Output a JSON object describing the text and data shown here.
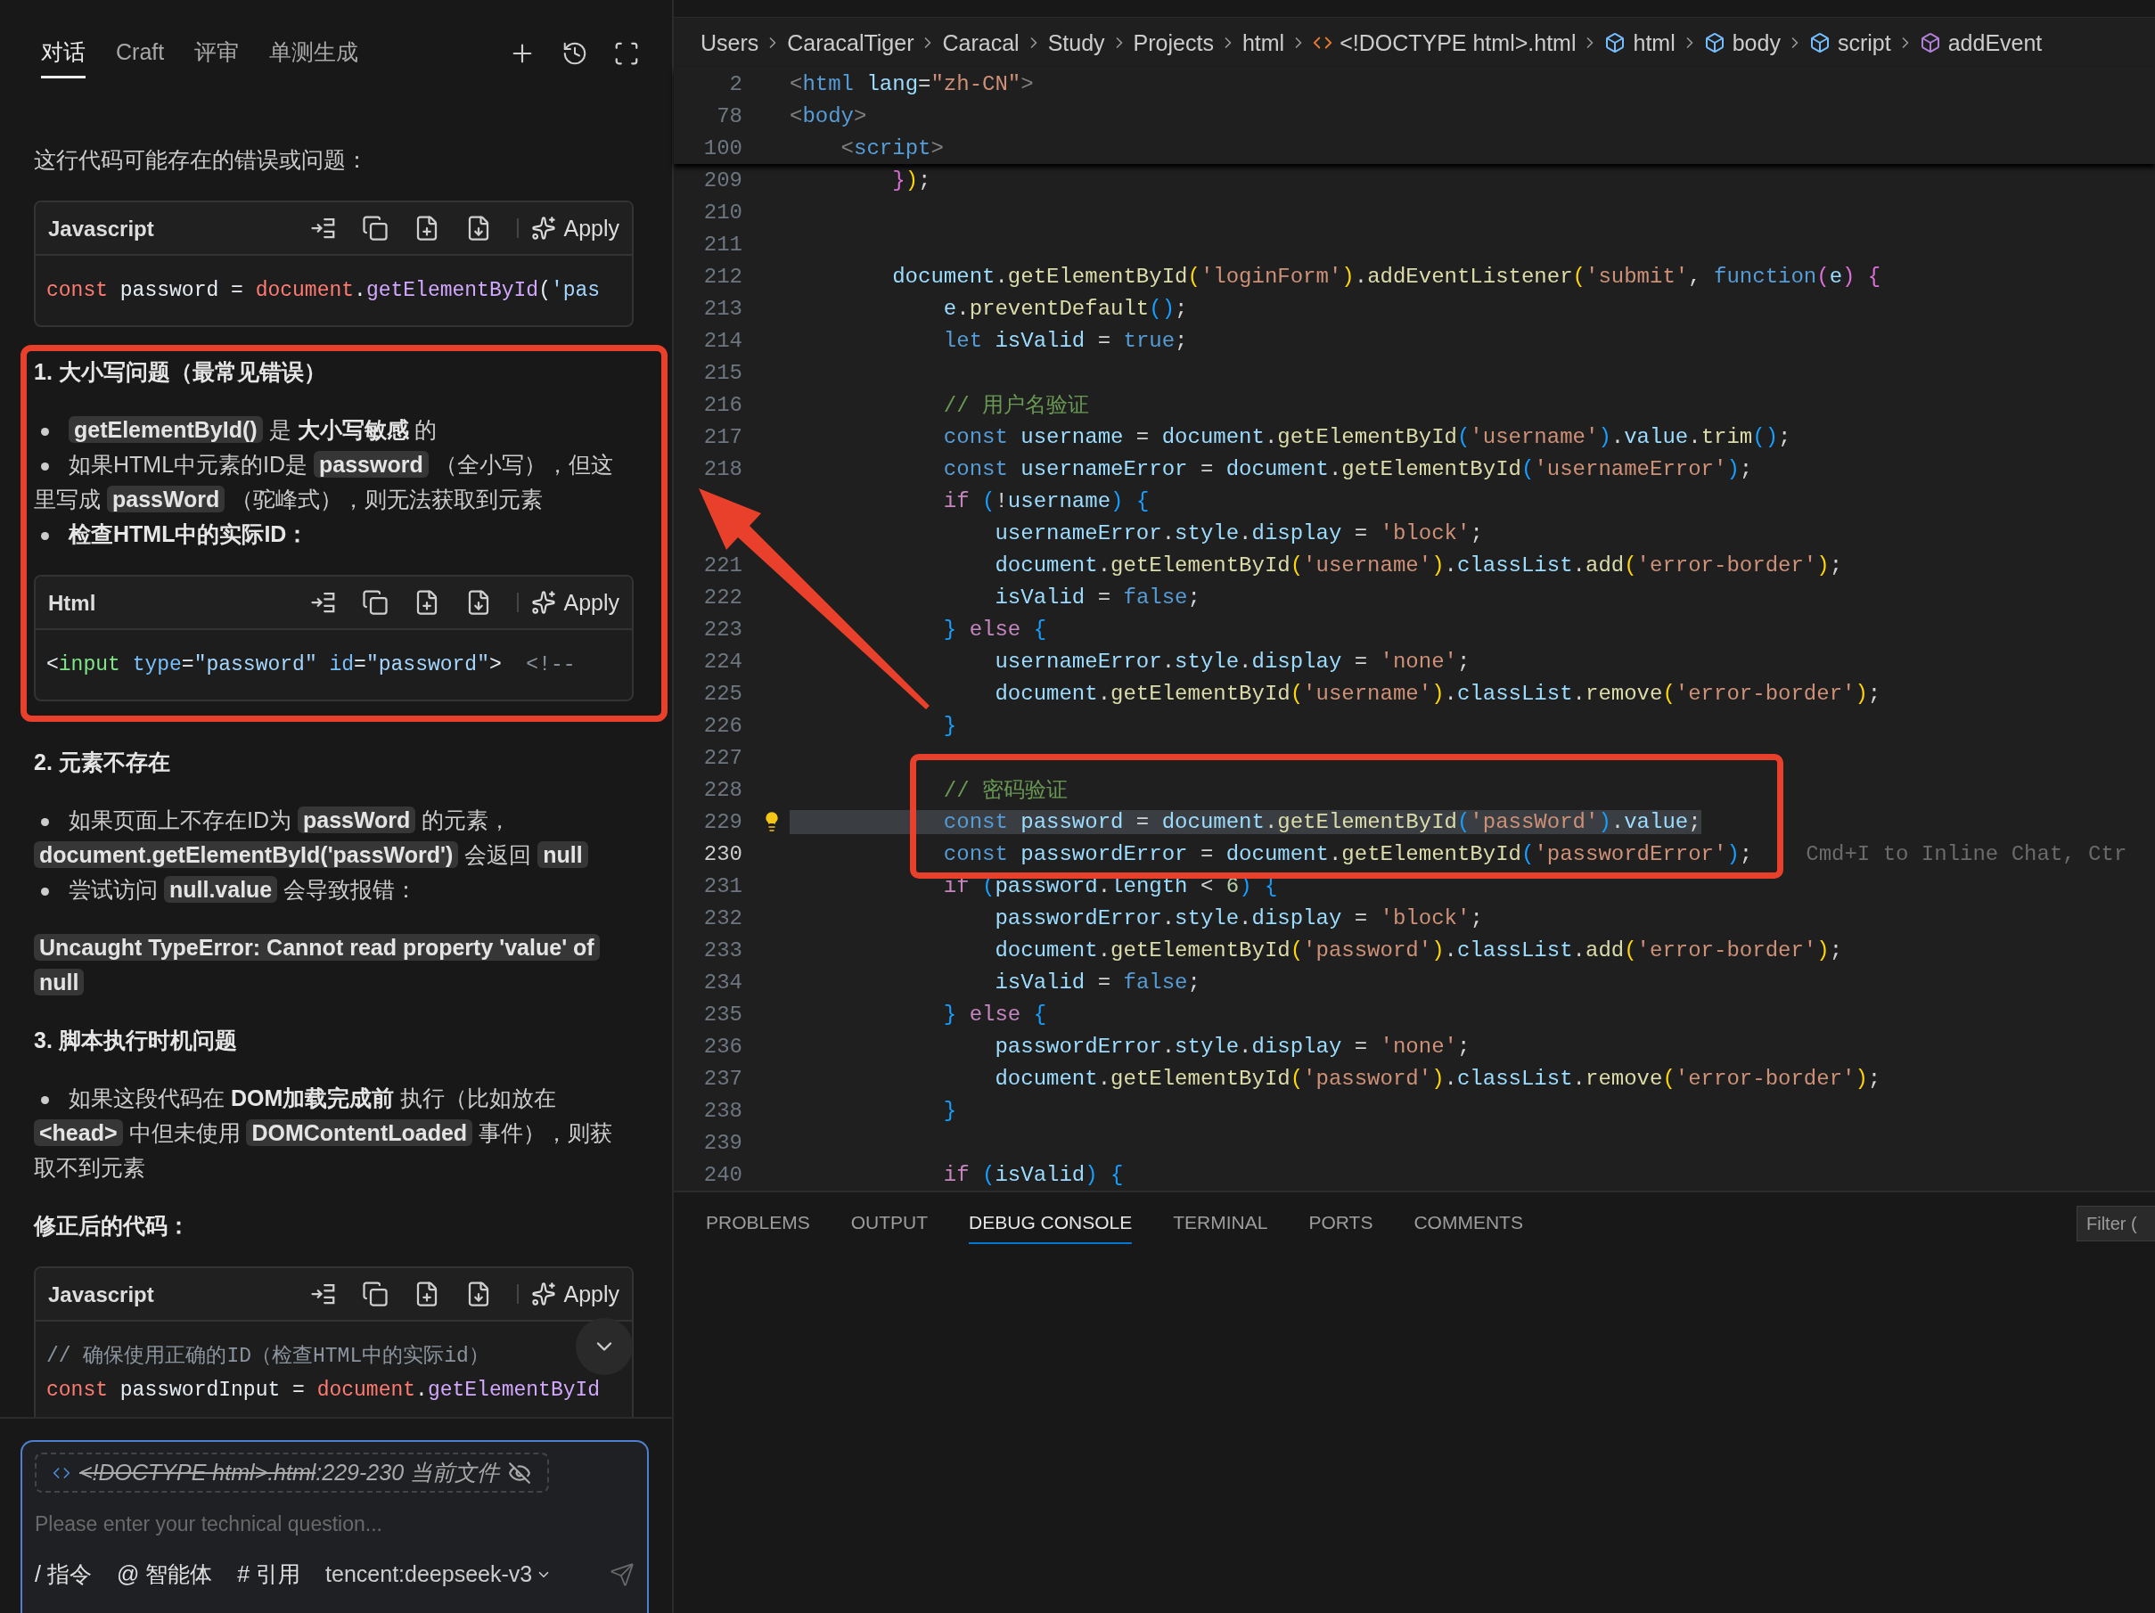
{
  "chat": {
    "tabs": [
      {
        "label": "对话",
        "selected": true
      },
      {
        "label": "Craft",
        "selected": false
      },
      {
        "label": "评审",
        "selected": false
      },
      {
        "label": "单测生成",
        "selected": false
      }
    ],
    "blocks": [
      {
        "kind": "paragraph",
        "highlighted": false,
        "segments": [
          {
            "kind": "text",
            "text": "这行代码可能存在的错误或问题："
          }
        ]
      },
      {
        "kind": "code",
        "highlighted": false,
        "language": "Javascript",
        "action": "Apply",
        "lines": [
          [
            {
              "kind": "keyword",
              "text": "const"
            },
            {
              "kind": "plain",
              "text": " password = "
            },
            {
              "kind": "keyword",
              "text": "document"
            },
            {
              "kind": "plain",
              "text": "."
            },
            {
              "kind": "function",
              "text": "getElementById"
            },
            {
              "kind": "plain",
              "text": "("
            },
            {
              "kind": "string",
              "text": "'pas"
            }
          ]
        ]
      },
      {
        "kind": "heading",
        "highlighted": true,
        "text": "1. 大小写问题（最常见错误）"
      },
      {
        "kind": "bullets",
        "highlighted": true,
        "items": [
          [
            {
              "kind": "code",
              "text": "getElementById()"
            },
            {
              "kind": "text",
              "text": " 是 "
            },
            {
              "kind": "bold",
              "text": "大小写敏感"
            },
            {
              "kind": "text",
              "text": " 的"
            }
          ],
          [
            {
              "kind": "text",
              "text": "如果HTML中元素的ID是 "
            },
            {
              "kind": "code",
              "text": "password"
            },
            {
              "kind": "text",
              "text": " （全小写），但这里写成 "
            },
            {
              "kind": "code",
              "text": "passWord"
            },
            {
              "kind": "text",
              "text": " （驼峰式），则无法获取到元素"
            }
          ],
          [
            {
              "kind": "bold",
              "text": "检查HTML中的实际ID："
            }
          ]
        ]
      },
      {
        "kind": "code",
        "highlighted": true,
        "language": "Html",
        "action": "Apply",
        "lines": [
          [
            {
              "kind": "plain",
              "text": "<"
            },
            {
              "kind": "tag",
              "text": "input"
            },
            {
              "kind": "attribute",
              "text": " type"
            },
            {
              "kind": "plain",
              "text": "="
            },
            {
              "kind": "string",
              "text": "\"password\""
            },
            {
              "kind": "attribute",
              "text": " id"
            },
            {
              "kind": "plain",
              "text": "="
            },
            {
              "kind": "string",
              "text": "\"password\""
            },
            {
              "kind": "plain",
              "text": ">"
            },
            {
              "kind": "comment",
              "text": "  <!--"
            }
          ]
        ]
      },
      {
        "kind": "heading",
        "highlighted": false,
        "text": "2. 元素不存在"
      },
      {
        "kind": "bullets",
        "highlighted": false,
        "items": [
          [
            {
              "kind": "text",
              "text": "如果页面上不存在ID为 "
            },
            {
              "kind": "code",
              "text": "passWord"
            },
            {
              "kind": "text",
              "text": " 的元素，"
            },
            {
              "kind": "code",
              "text": "document.getElementById('passWord')"
            },
            {
              "kind": "text",
              "text": " 会返回 "
            },
            {
              "kind": "code",
              "text": "null"
            }
          ],
          [
            {
              "kind": "text",
              "text": "尝试访问 "
            },
            {
              "kind": "code",
              "text": "null.value"
            },
            {
              "kind": "text",
              "text": " 会导致报错："
            }
          ]
        ]
      },
      {
        "kind": "paragraph",
        "highlighted": false,
        "segments": [
          {
            "kind": "code",
            "text": "Uncaught TypeError: Cannot read property 'value' of null"
          }
        ]
      },
      {
        "kind": "heading",
        "highlighted": false,
        "text": "3. 脚本执行时机问题"
      },
      {
        "kind": "bullets",
        "highlighted": false,
        "items": [
          [
            {
              "kind": "text",
              "text": "如果这段代码在 "
            },
            {
              "kind": "bold",
              "text": "DOM加载完成前"
            },
            {
              "kind": "text",
              "text": " 执行（比如放在 "
            },
            {
              "kind": "code",
              "text": "<head>"
            },
            {
              "kind": "text",
              "text": " 中但未使用 "
            },
            {
              "kind": "code",
              "text": "DOMContentLoaded"
            },
            {
              "kind": "text",
              "text": " 事件），则获取不到元素"
            }
          ]
        ]
      },
      {
        "kind": "heading",
        "highlighted": false,
        "text": "修正后的代码："
      },
      {
        "kind": "code",
        "highlighted": false,
        "language": "Javascript",
        "action": "Apply",
        "lines": [
          [
            {
              "kind": "comment",
              "text": "// 确保使用正确的ID（检查HTML中的实际id）"
            }
          ],
          [
            {
              "kind": "keyword",
              "text": "const"
            },
            {
              "kind": "plain",
              "text": " passwordInput = "
            },
            {
              "kind": "keyword",
              "text": "document"
            },
            {
              "kind": "plain",
              "text": "."
            },
            {
              "kind": "function",
              "text": "getElementById"
            }
          ]
        ]
      }
    ],
    "input": {
      "context": {
        "file": "<!DOCTYPE html>.html",
        "range": ":229-230",
        "label": "当前文件",
        "enabled": false
      },
      "placeholder": "Please enter your technical question...",
      "commands": [
        "/ 指令",
        "@ 智能体",
        "# 引用"
      ],
      "model": "tencent:deepseek-v3"
    }
  },
  "editor": {
    "breadcrumb": [
      {
        "label": "Users",
        "kind": "folder"
      },
      {
        "label": "CaracalTiger",
        "kind": "folder"
      },
      {
        "label": "Caracal",
        "kind": "folder"
      },
      {
        "label": "Study",
        "kind": "folder"
      },
      {
        "label": "Projects",
        "kind": "folder"
      },
      {
        "label": "html",
        "kind": "folder"
      },
      {
        "label": "<!DOCTYPE html>.html",
        "kind": "file"
      },
      {
        "label": "html",
        "kind": "element"
      },
      {
        "label": "body",
        "kind": "element"
      },
      {
        "label": "script",
        "kind": "element"
      },
      {
        "label": "addEvent",
        "kind": "function"
      }
    ],
    "sticky_lines": [
      {
        "number": "2",
        "tokens": [
          {
            "kind": "punct",
            "text": "<"
          },
          {
            "kind": "tag",
            "text": "html"
          },
          {
            "kind": "variable",
            "text": " lang"
          },
          {
            "kind": "plain",
            "text": "="
          },
          {
            "kind": "string",
            "text": "\"zh-CN\""
          },
          {
            "kind": "punct",
            "text": ">"
          }
        ]
      },
      {
        "number": "78",
        "tokens": [
          {
            "kind": "punct",
            "text": "<"
          },
          {
            "kind": "tag",
            "text": "body"
          },
          {
            "kind": "punct",
            "text": ">"
          }
        ]
      },
      {
        "number": "100",
        "tokens": [
          {
            "kind": "punct",
            "text": "    <"
          },
          {
            "kind": "tag",
            "text": "script"
          },
          {
            "kind": "punct",
            "text": ">"
          }
        ]
      }
    ],
    "lines": [
      {
        "number": "209",
        "tokens": [
          {
            "kind": "bracket_b",
            "text": "        }"
          },
          {
            "kind": "bracket_a",
            "text": ")"
          },
          {
            "kind": "plain",
            "text": ";"
          }
        ]
      },
      {
        "number": "210"
      },
      {
        "number": "211"
      },
      {
        "number": "212",
        "tokens": [
          {
            "kind": "variable",
            "text": "        document"
          },
          {
            "kind": "plain",
            "text": "."
          },
          {
            "kind": "function",
            "text": "getElementById"
          },
          {
            "kind": "bracket_a",
            "text": "("
          },
          {
            "kind": "string",
            "text": "'loginForm'"
          },
          {
            "kind": "bracket_a",
            "text": ")"
          },
          {
            "kind": "plain",
            "text": "."
          },
          {
            "kind": "function",
            "text": "addEventListener"
          },
          {
            "kind": "bracket_a",
            "text": "("
          },
          {
            "kind": "string",
            "text": "'submit'"
          },
          {
            "kind": "plain",
            "text": ", "
          },
          {
            "kind": "keyword",
            "text": "function"
          },
          {
            "kind": "bracket_b",
            "text": "("
          },
          {
            "kind": "variable",
            "text": "e"
          },
          {
            "kind": "bracket_b",
            "text": ") {"
          }
        ]
      },
      {
        "number": "213",
        "tokens": [
          {
            "kind": "variable",
            "text": "            e"
          },
          {
            "kind": "plain",
            "text": "."
          },
          {
            "kind": "function",
            "text": "preventDefault"
          },
          {
            "kind": "bracket_c",
            "text": "()"
          },
          {
            "kind": "plain",
            "text": ";"
          }
        ]
      },
      {
        "number": "214",
        "tokens": [
          {
            "kind": "keyword",
            "text": "            let"
          },
          {
            "kind": "variable",
            "text": " isValid"
          },
          {
            "kind": "plain",
            "text": " = "
          },
          {
            "kind": "keyword",
            "text": "true"
          },
          {
            "kind": "plain",
            "text": ";"
          }
        ]
      },
      {
        "number": "215"
      },
      {
        "number": "216",
        "tokens": [
          {
            "kind": "comment",
            "text": "            // 用户名验证"
          }
        ]
      },
      {
        "number": "217",
        "tokens": [
          {
            "kind": "keyword",
            "text": "            const"
          },
          {
            "kind": "variable",
            "text": " username"
          },
          {
            "kind": "plain",
            "text": " = "
          },
          {
            "kind": "variable",
            "text": "document"
          },
          {
            "kind": "plain",
            "text": "."
          },
          {
            "kind": "function",
            "text": "getElementById"
          },
          {
            "kind": "bracket_c",
            "text": "("
          },
          {
            "kind": "string",
            "text": "'username'"
          },
          {
            "kind": "bracket_c",
            "text": ")"
          },
          {
            "kind": "plain",
            "text": "."
          },
          {
            "kind": "variable",
            "text": "value"
          },
          {
            "kind": "plain",
            "text": "."
          },
          {
            "kind": "function",
            "text": "trim"
          },
          {
            "kind": "bracket_c",
            "text": "()"
          },
          {
            "kind": "plain",
            "text": ";"
          }
        ]
      },
      {
        "number": "218",
        "tokens": [
          {
            "kind": "keyword",
            "text": "            const"
          },
          {
            "kind": "variable",
            "text": " usernameError"
          },
          {
            "kind": "plain",
            "text": " = "
          },
          {
            "kind": "variable",
            "text": "document"
          },
          {
            "kind": "plain",
            "text": "."
          },
          {
            "kind": "function",
            "text": "getElementById"
          },
          {
            "kind": "bracket_c",
            "text": "("
          },
          {
            "kind": "string",
            "text": "'usernameError'"
          },
          {
            "kind": "bracket_c",
            "text": ")"
          },
          {
            "kind": "plain",
            "text": ";"
          }
        ]
      },
      {
        "tokens": [
          {
            "kind": "control",
            "text": "            if"
          },
          {
            "kind": "bracket_c",
            "text": " ("
          },
          {
            "kind": "plain",
            "text": "!"
          },
          {
            "kind": "variable",
            "text": "username"
          },
          {
            "kind": "bracket_c",
            "text": ") {"
          }
        ]
      },
      {
        "tokens": [
          {
            "kind": "variable",
            "text": "                usernameError"
          },
          {
            "kind": "plain",
            "text": "."
          },
          {
            "kind": "variable",
            "text": "style"
          },
          {
            "kind": "plain",
            "text": "."
          },
          {
            "kind": "variable",
            "text": "display"
          },
          {
            "kind": "plain",
            "text": " = "
          },
          {
            "kind": "string",
            "text": "'block'"
          },
          {
            "kind": "plain",
            "text": ";"
          }
        ]
      },
      {
        "number": "221",
        "tokens": [
          {
            "kind": "variable",
            "text": "                document"
          },
          {
            "kind": "plain",
            "text": "."
          },
          {
            "kind": "function",
            "text": "getElementById"
          },
          {
            "kind": "bracket_a",
            "text": "("
          },
          {
            "kind": "string",
            "text": "'username'"
          },
          {
            "kind": "bracket_a",
            "text": ")"
          },
          {
            "kind": "plain",
            "text": "."
          },
          {
            "kind": "variable",
            "text": "classList"
          },
          {
            "kind": "plain",
            "text": "."
          },
          {
            "kind": "function",
            "text": "add"
          },
          {
            "kind": "bracket_a",
            "text": "("
          },
          {
            "kind": "string",
            "text": "'error-border'"
          },
          {
            "kind": "bracket_a",
            "text": ")"
          },
          {
            "kind": "plain",
            "text": ";"
          }
        ]
      },
      {
        "number": "222",
        "tokens": [
          {
            "kind": "variable",
            "text": "                isValid"
          },
          {
            "kind": "plain",
            "text": " = "
          },
          {
            "kind": "keyword",
            "text": "false"
          },
          {
            "kind": "plain",
            "text": ";"
          }
        ]
      },
      {
        "number": "223",
        "tokens": [
          {
            "kind": "bracket_c",
            "text": "            }"
          },
          {
            "kind": "control",
            "text": " else"
          },
          {
            "kind": "bracket_c",
            "text": " {"
          }
        ]
      },
      {
        "number": "224",
        "tokens": [
          {
            "kind": "variable",
            "text": "                usernameError"
          },
          {
            "kind": "plain",
            "text": "."
          },
          {
            "kind": "variable",
            "text": "style"
          },
          {
            "kind": "plain",
            "text": "."
          },
          {
            "kind": "variable",
            "text": "display"
          },
          {
            "kind": "plain",
            "text": " = "
          },
          {
            "kind": "string",
            "text": "'none'"
          },
          {
            "kind": "plain",
            "text": ";"
          }
        ]
      },
      {
        "number": "225",
        "tokens": [
          {
            "kind": "variable",
            "text": "                document"
          },
          {
            "kind": "plain",
            "text": "."
          },
          {
            "kind": "function",
            "text": "getElementById"
          },
          {
            "kind": "bracket_a",
            "text": "("
          },
          {
            "kind": "string",
            "text": "'username'"
          },
          {
            "kind": "bracket_a",
            "text": ")"
          },
          {
            "kind": "plain",
            "text": "."
          },
          {
            "kind": "variable",
            "text": "classList"
          },
          {
            "kind": "plain",
            "text": "."
          },
          {
            "kind": "function",
            "text": "remove"
          },
          {
            "kind": "bracket_a",
            "text": "("
          },
          {
            "kind": "string",
            "text": "'error-border'"
          },
          {
            "kind": "bracket_a",
            "text": ")"
          },
          {
            "kind": "plain",
            "text": ";"
          }
        ]
      },
      {
        "number": "226",
        "tokens": [
          {
            "kind": "bracket_c",
            "text": "            }"
          }
        ]
      },
      {
        "number": "227"
      },
      {
        "number": "228",
        "boxed": true,
        "tokens": [
          {
            "kind": "comment",
            "text": "            // 密码验证"
          }
        ]
      },
      {
        "number": "229",
        "boxed": true,
        "selection": true,
        "lightbulb": true,
        "tokens": [
          {
            "kind": "keyword",
            "text": "            const"
          },
          {
            "kind": "variable",
            "text": " password"
          },
          {
            "kind": "plain",
            "text": " = "
          },
          {
            "kind": "variable",
            "text": "document"
          },
          {
            "kind": "plain",
            "text": "."
          },
          {
            "kind": "function",
            "text": "getElementById"
          },
          {
            "kind": "bracket_c",
            "text": "("
          },
          {
            "kind": "string",
            "text": "'passWord'"
          },
          {
            "kind": "bracket_c",
            "text": ")"
          },
          {
            "kind": "plain",
            "text": "."
          },
          {
            "kind": "variable",
            "text": "value"
          },
          {
            "kind": "plain",
            "text": ";"
          }
        ]
      },
      {
        "number": "230",
        "boxed": true,
        "current": true,
        "hint": "Cmd+I to Inline Chat, Ctr",
        "tokens": [
          {
            "kind": "keyword",
            "text": "            const"
          },
          {
            "kind": "variable",
            "text": " passwordError"
          },
          {
            "kind": "plain",
            "text": " = "
          },
          {
            "kind": "variable",
            "text": "document"
          },
          {
            "kind": "plain",
            "text": "."
          },
          {
            "kind": "function",
            "text": "getElementById"
          },
          {
            "kind": "bracket_c",
            "text": "("
          },
          {
            "kind": "string",
            "text": "'passwordError'"
          },
          {
            "kind": "bracket_c",
            "text": ")"
          },
          {
            "kind": "plain",
            "text": ";"
          }
        ]
      },
      {
        "number": "231",
        "tokens": [
          {
            "kind": "control",
            "text": "            if"
          },
          {
            "kind": "bracket_c",
            "text": " ("
          },
          {
            "kind": "variable",
            "text": "password"
          },
          {
            "kind": "plain",
            "text": "."
          },
          {
            "kind": "variable",
            "text": "length"
          },
          {
            "kind": "plain",
            "text": " < "
          },
          {
            "kind": "number",
            "text": "6"
          },
          {
            "kind": "bracket_c",
            "text": ") {"
          }
        ]
      },
      {
        "number": "232",
        "tokens": [
          {
            "kind": "variable",
            "text": "                passwordError"
          },
          {
            "kind": "plain",
            "text": "."
          },
          {
            "kind": "variable",
            "text": "style"
          },
          {
            "kind": "plain",
            "text": "."
          },
          {
            "kind": "variable",
            "text": "display"
          },
          {
            "kind": "plain",
            "text": " = "
          },
          {
            "kind": "string",
            "text": "'block'"
          },
          {
            "kind": "plain",
            "text": ";"
          }
        ]
      },
      {
        "number": "233",
        "tokens": [
          {
            "kind": "variable",
            "text": "                document"
          },
          {
            "kind": "plain",
            "text": "."
          },
          {
            "kind": "function",
            "text": "getElementById"
          },
          {
            "kind": "bracket_a",
            "text": "("
          },
          {
            "kind": "string",
            "text": "'password'"
          },
          {
            "kind": "bracket_a",
            "text": ")"
          },
          {
            "kind": "plain",
            "text": "."
          },
          {
            "kind": "variable",
            "text": "classList"
          },
          {
            "kind": "plain",
            "text": "."
          },
          {
            "kind": "function",
            "text": "add"
          },
          {
            "kind": "bracket_a",
            "text": "("
          },
          {
            "kind": "string",
            "text": "'error-border'"
          },
          {
            "kind": "bracket_a",
            "text": ")"
          },
          {
            "kind": "plain",
            "text": ";"
          }
        ]
      },
      {
        "number": "234",
        "tokens": [
          {
            "kind": "variable",
            "text": "                isValid"
          },
          {
            "kind": "plain",
            "text": " = "
          },
          {
            "kind": "keyword",
            "text": "false"
          },
          {
            "kind": "plain",
            "text": ";"
          }
        ]
      },
      {
        "number": "235",
        "tokens": [
          {
            "kind": "bracket_c",
            "text": "            }"
          },
          {
            "kind": "control",
            "text": " else"
          },
          {
            "kind": "bracket_c",
            "text": " {"
          }
        ]
      },
      {
        "number": "236",
        "tokens": [
          {
            "kind": "variable",
            "text": "                passwordError"
          },
          {
            "kind": "plain",
            "text": "."
          },
          {
            "kind": "variable",
            "text": "style"
          },
          {
            "kind": "plain",
            "text": "."
          },
          {
            "kind": "variable",
            "text": "display"
          },
          {
            "kind": "plain",
            "text": " = "
          },
          {
            "kind": "string",
            "text": "'none'"
          },
          {
            "kind": "plain",
            "text": ";"
          }
        ]
      },
      {
        "number": "237",
        "tokens": [
          {
            "kind": "variable",
            "text": "                document"
          },
          {
            "kind": "plain",
            "text": "."
          },
          {
            "kind": "function",
            "text": "getElementById"
          },
          {
            "kind": "bracket_a",
            "text": "("
          },
          {
            "kind": "string",
            "text": "'password'"
          },
          {
            "kind": "bracket_a",
            "text": ")"
          },
          {
            "kind": "plain",
            "text": "."
          },
          {
            "kind": "variable",
            "text": "classList"
          },
          {
            "kind": "plain",
            "text": "."
          },
          {
            "kind": "function",
            "text": "remove"
          },
          {
            "kind": "bracket_a",
            "text": "("
          },
          {
            "kind": "string",
            "text": "'error-border'"
          },
          {
            "kind": "bracket_a",
            "text": ")"
          },
          {
            "kind": "plain",
            "text": ";"
          }
        ]
      },
      {
        "number": "238",
        "tokens": [
          {
            "kind": "bracket_c",
            "text": "            }"
          }
        ]
      },
      {
        "number": "239"
      },
      {
        "number": "240",
        "tokens": [
          {
            "kind": "control",
            "text": "            if"
          },
          {
            "kind": "bracket_c",
            "text": " ("
          },
          {
            "kind": "variable",
            "text": "isValid"
          },
          {
            "kind": "bracket_c",
            "text": ") {"
          }
        ]
      }
    ]
  },
  "panel": {
    "tabs": [
      {
        "label": "PROBLEMS",
        "selected": false
      },
      {
        "label": "OUTPUT",
        "selected": false
      },
      {
        "label": "DEBUG CONSOLE",
        "selected": true
      },
      {
        "label": "TERMINAL",
        "selected": false
      },
      {
        "label": "PORTS",
        "selected": false
      },
      {
        "label": "COMMENTS",
        "selected": false
      }
    ],
    "filter": {
      "placeholder": "Filter ("
    }
  }
}
